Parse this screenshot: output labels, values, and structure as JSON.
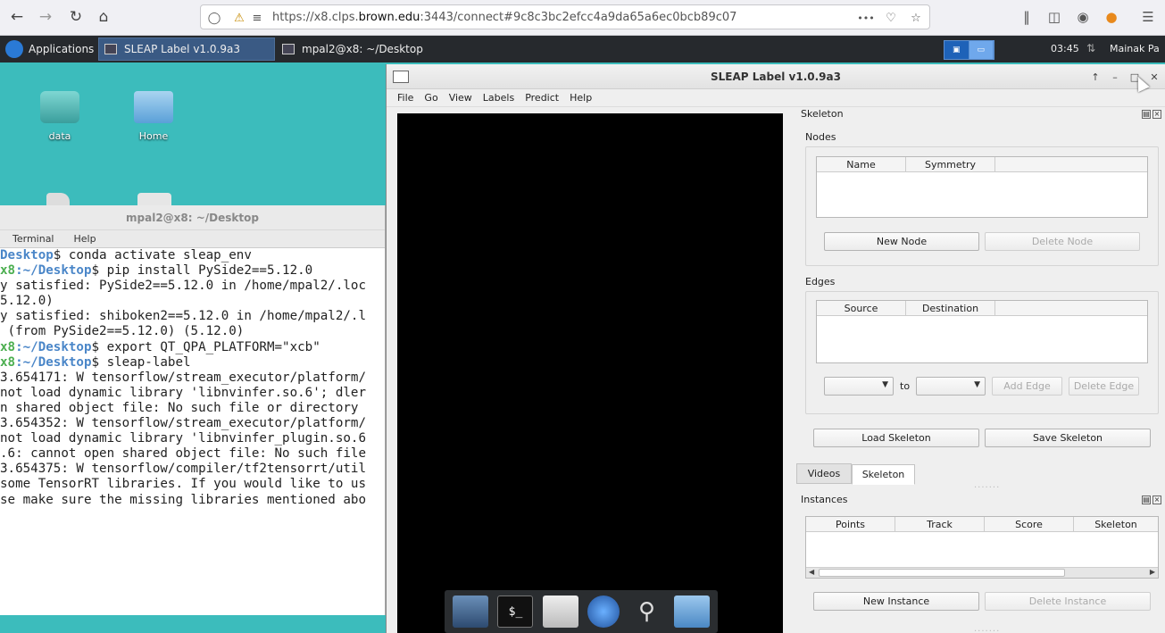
{
  "browser": {
    "url_prefix": "https://x8.clps.",
    "url_host": "brown.edu",
    "url_rest": ":3443/connect#9c8c3bc2efcc4a9da65a6ec0bcb89c07",
    "more_glyph": "•••"
  },
  "panel": {
    "applications_label": "Applications",
    "tasks": [
      {
        "label": "SLEAP Label v1.0.9a3",
        "active": true
      },
      {
        "label": "mpal2@x8: ~/Desktop",
        "active": false
      }
    ],
    "clock": "03:45",
    "user": "Mainak Pa"
  },
  "desktop_icons": [
    {
      "label": "data"
    },
    {
      "label": "Home"
    }
  ],
  "terminal": {
    "title": "mpal2@x8: ~/Desktop",
    "menu": [
      "Terminal",
      "Help"
    ],
    "lines": [
      {
        "host": "",
        "path": "Desktop",
        "rest": "$ conda activate sleap_env"
      },
      {
        "host": "x8",
        "path": ":~/Desktop",
        "rest": "$ pip install PySide2==5.12.0"
      },
      {
        "host": "",
        "path": "",
        "rest": "y satisfied: PySide2==5.12.0 in /home/mpal2/.loc"
      },
      {
        "host": "",
        "path": "",
        "rest": "5.12.0)"
      },
      {
        "host": "",
        "path": "",
        "rest": "y satisfied: shiboken2==5.12.0 in /home/mpal2/.l"
      },
      {
        "host": "",
        "path": "",
        "rest": " (from PySide2==5.12.0) (5.12.0)"
      },
      {
        "host": "x8",
        "path": ":~/Desktop",
        "rest": "$ export QT_QPA_PLATFORM=\"xcb\""
      },
      {
        "host": "x8",
        "path": ":~/Desktop",
        "rest": "$ sleap-label"
      },
      {
        "host": "",
        "path": "",
        "rest": "3.654171: W tensorflow/stream_executor/platform/"
      },
      {
        "host": "",
        "path": "",
        "rest": "not load dynamic library 'libnvinfer.so.6'; dler"
      },
      {
        "host": "",
        "path": "",
        "rest": "n shared object file: No such file or directory"
      },
      {
        "host": "",
        "path": "",
        "rest": "3.654352: W tensorflow/stream_executor/platform/"
      },
      {
        "host": "",
        "path": "",
        "rest": "not load dynamic library 'libnvinfer_plugin.so.6"
      },
      {
        "host": "",
        "path": "",
        "rest": ".6: cannot open shared object file: No such file"
      },
      {
        "host": "",
        "path": "",
        "rest": "3.654375: W tensorflow/compiler/tf2tensorrt/util"
      },
      {
        "host": "",
        "path": "",
        "rest": "some TensorRT libraries. If you would like to us"
      },
      {
        "host": "",
        "path": "",
        "rest": "se make sure the missing libraries mentioned abo"
      }
    ]
  },
  "sleap": {
    "title": "SLEAP Label v1.0.9a3",
    "menu": [
      "File",
      "Go",
      "View",
      "Labels",
      "Predict",
      "Help"
    ],
    "skeleton_panel": {
      "title": "Skeleton",
      "nodes_label": "Nodes",
      "nodes_columns": [
        "Name",
        "Symmetry"
      ],
      "new_node": "New Node",
      "delete_node": "Delete Node",
      "edges_label": "Edges",
      "edges_columns": [
        "Source",
        "Destination"
      ],
      "to_label": "to",
      "add_edge": "Add Edge",
      "delete_edge": "Delete Edge",
      "load_skeleton": "Load Skeleton",
      "save_skeleton": "Save Skeleton"
    },
    "tabs": [
      "Videos",
      "Skeleton"
    ],
    "active_tab": "Skeleton",
    "instances_panel": {
      "title": "Instances",
      "columns": [
        "Points",
        "Track",
        "Score",
        "Skeleton"
      ],
      "new_instance": "New Instance",
      "delete_instance": "Delete Instance"
    }
  },
  "dock": {
    "terminal_glyph": "$_"
  }
}
